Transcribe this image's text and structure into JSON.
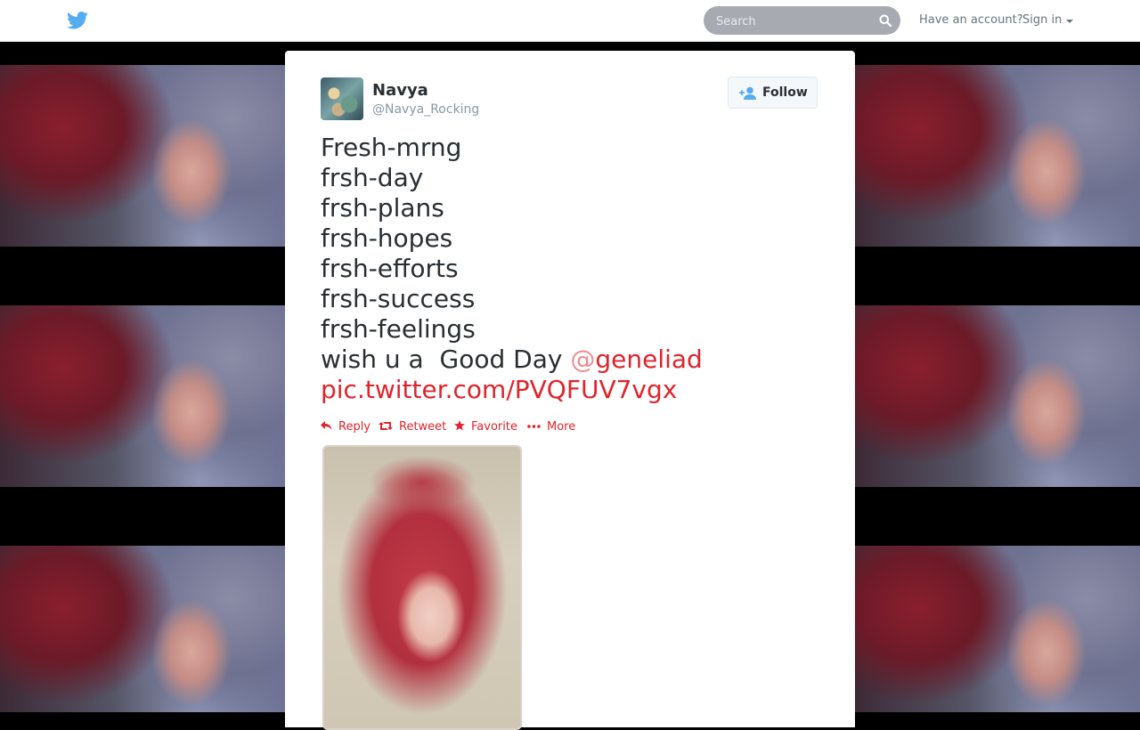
{
  "nav": {
    "search_placeholder": "Search",
    "account_question": "Have an account?",
    "signin_label": "Sign in"
  },
  "tweet": {
    "fullname": "Navya",
    "username": "@Navya_Rocking",
    "follow_label": "Follow",
    "lines": [
      "Fresh-mrng",
      "frsh-day",
      "frsh-plans",
      "frsh-hopes",
      "frsh-efforts",
      "frsh-success",
      "frsh-feelings"
    ],
    "last_line_prefix": "wish u a  Good Day ",
    "mention_at": "@",
    "mention_name": "geneliad",
    "pic_link": "pic.twitter.com/PVQFUV7vgx"
  },
  "actions": {
    "reply": "Reply",
    "retweet": "Retweet",
    "favorite": "Favorite",
    "more": "More"
  },
  "colors": {
    "accent": "#e0242c",
    "twitter_blue": "#55acee"
  }
}
